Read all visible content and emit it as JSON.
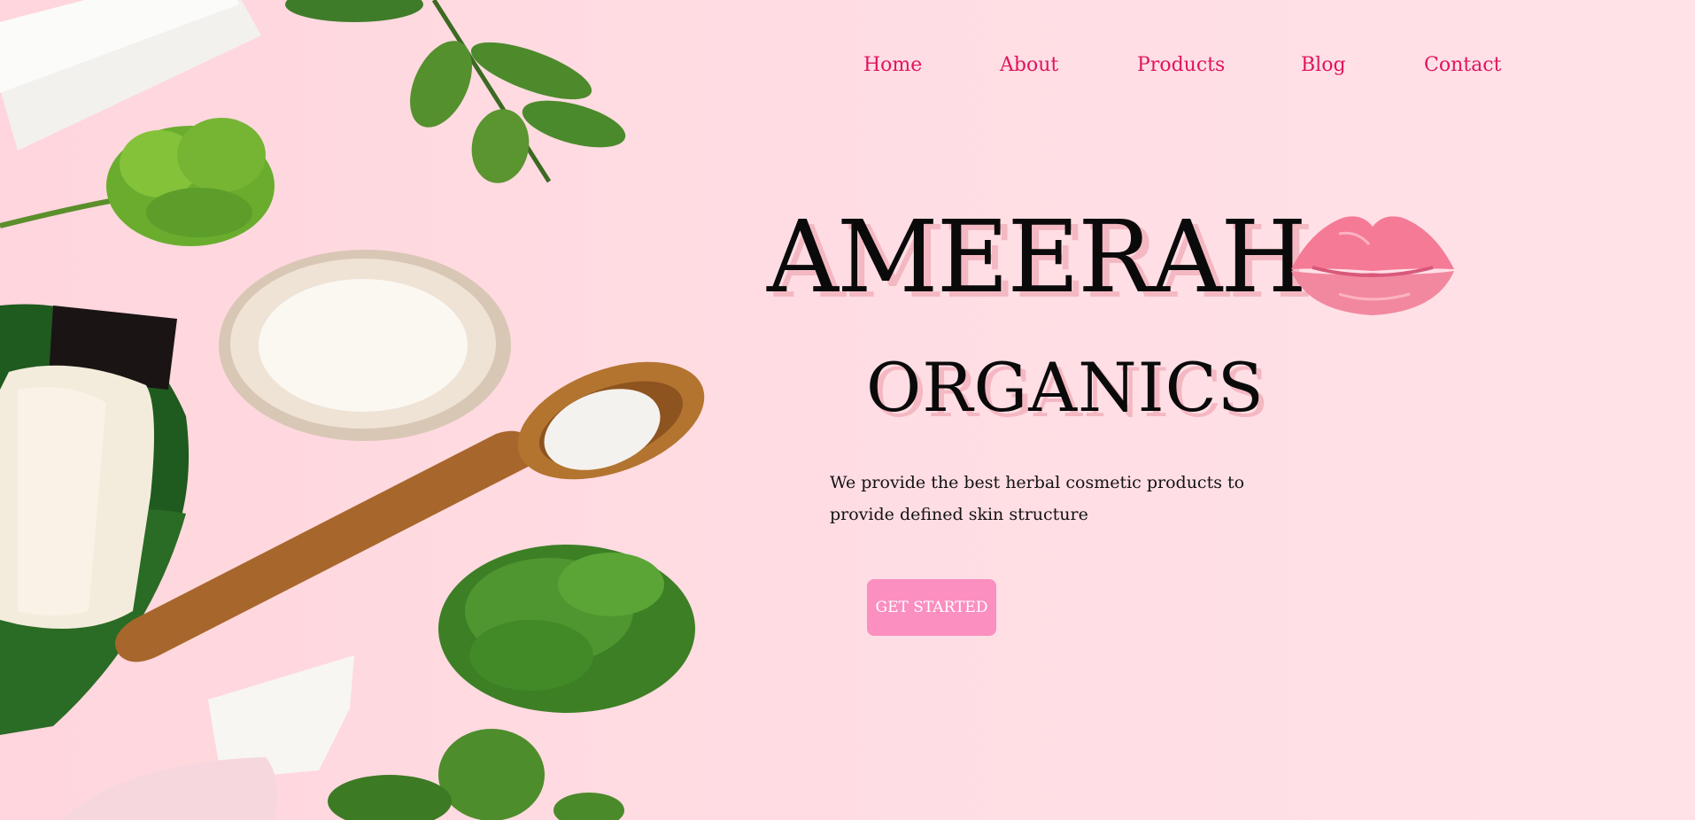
{
  "nav": {
    "items": [
      {
        "label": "Home"
      },
      {
        "label": "About"
      },
      {
        "label": "Products"
      },
      {
        "label": "Blog"
      },
      {
        "label": "Contact"
      }
    ]
  },
  "hero": {
    "title": "AMEERAH",
    "subtitle": "ORGANICS",
    "tagline": "We provide the best herbal cosmetic products to provide defined skin structure",
    "cta_label": "GET STARTED"
  },
  "icons": {
    "logo": "lips-kiss-icon"
  },
  "colors": {
    "accent": "#e0145e",
    "button": "#fa8fc0",
    "background": "#ffdde3",
    "title_shadow": "#f4b8c2"
  }
}
